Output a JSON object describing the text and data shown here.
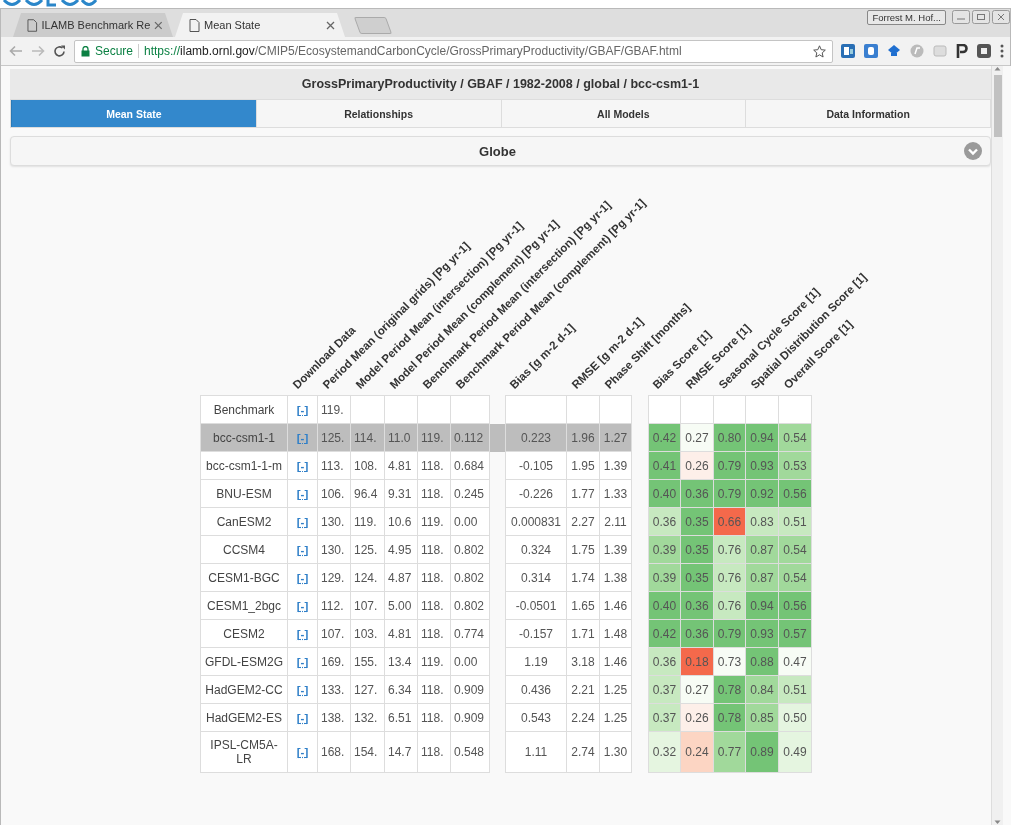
{
  "browser": {
    "tabs": [
      {
        "title": "ILAMB Benchmark Re",
        "selected": false
      },
      {
        "title": "Mean State",
        "selected": true
      }
    ],
    "profile": "Forrest M. Hof...",
    "address": {
      "secure_label": "Secure",
      "scheme": "https://",
      "host": "ilamb.ornl.gov",
      "path": "/CMIP5/EcosystemandCarbonCycle/GrossPrimaryProductivity/GBAF/GBAF.html"
    }
  },
  "page": {
    "title": "GrossPrimaryProductivity / GBAF / 1982-2008 / global / bcc-csm1-1",
    "tabs": [
      {
        "label": "Mean State",
        "selected": true
      },
      {
        "label": "Relationships",
        "selected": false
      },
      {
        "label": "All Models",
        "selected": false
      },
      {
        "label": "Data Information",
        "selected": false
      }
    ],
    "section": {
      "title": "Globe"
    }
  },
  "table": {
    "columns": {
      "means": [
        "Download Data",
        "Period Mean (original grids) [Pg yr-1]",
        "Model Period Mean (intersection) [Pg yr-1]",
        "Model Period Mean (complement) [Pg yr-1]",
        "Benchmark Period Mean (intersection) [Pg yr-1]",
        "Benchmark Period Mean (complement) [Pg yr-1]"
      ],
      "cycle": [
        "Bias [g m-2 d-1]",
        "RMSE [g m-2 d-1]",
        "Phase Shift [months]"
      ],
      "scores": [
        "Bias Score [1]",
        "RMSE Score [1]",
        "Seasonal Cycle Score [1]",
        "Spatial Distribution Score [1]",
        "Overall Score [1]"
      ]
    },
    "rows": [
      {
        "model": "Benchmark",
        "selected": false,
        "download": "[-]",
        "means": [
          "119."
        ]
      },
      {
        "model": "bcc-csm1-1",
        "selected": true,
        "download": "[-]",
        "means": [
          "125.",
          "114.",
          "11.0",
          "119.",
          "0.112"
        ],
        "cycle": [
          "0.223",
          "1.96",
          "1.27"
        ],
        "scores": [
          {
            "value": "0.42",
            "color": "#74c476"
          },
          {
            "value": "0.27",
            "color": "#f7fcf5"
          },
          {
            "value": "0.80",
            "color": "#74c476"
          },
          {
            "value": "0.94",
            "color": "#74c476"
          },
          {
            "value": "0.54",
            "color": "#a1d99b"
          }
        ]
      },
      {
        "model": "bcc-csm1-1-m",
        "selected": false,
        "download": "[-]",
        "means": [
          "113.",
          "108.",
          "4.81",
          "118.",
          "0.684"
        ],
        "cycle": [
          "-0.105",
          "1.95",
          "1.39"
        ],
        "scores": [
          {
            "value": "0.41",
            "color": "#74c476"
          },
          {
            "value": "0.26",
            "color": "#fdefe9"
          },
          {
            "value": "0.79",
            "color": "#74c476"
          },
          {
            "value": "0.93",
            "color": "#74c476"
          },
          {
            "value": "0.53",
            "color": "#a1d99b"
          }
        ]
      },
      {
        "model": "BNU-ESM",
        "selected": false,
        "download": "[-]",
        "means": [
          "106.",
          "96.4",
          "9.31",
          "118.",
          "0.245"
        ],
        "cycle": [
          "-0.226",
          "1.77",
          "1.33"
        ],
        "scores": [
          {
            "value": "0.40",
            "color": "#74c476"
          },
          {
            "value": "0.36",
            "color": "#74c476"
          },
          {
            "value": "0.79",
            "color": "#74c476"
          },
          {
            "value": "0.92",
            "color": "#74c476"
          },
          {
            "value": "0.56",
            "color": "#74c476"
          }
        ]
      },
      {
        "model": "CanESM2",
        "selected": false,
        "download": "[-]",
        "means": [
          "130.",
          "119.",
          "10.6",
          "119.",
          "0.00"
        ],
        "cycle": [
          "0.000831",
          "2.27",
          "2.11"
        ],
        "scores": [
          {
            "value": "0.36",
            "color": "#c7e9c0"
          },
          {
            "value": "0.35",
            "color": "#74c476"
          },
          {
            "value": "0.66",
            "color": "#f4694b"
          },
          {
            "value": "0.83",
            "color": "#c7e9c0"
          },
          {
            "value": "0.51",
            "color": "#c7e9c0"
          }
        ]
      },
      {
        "model": "CCSM4",
        "selected": false,
        "download": "[-]",
        "means": [
          "130.",
          "125.",
          "4.95",
          "118.",
          "0.802"
        ],
        "cycle": [
          "0.324",
          "1.75",
          "1.39"
        ],
        "scores": [
          {
            "value": "0.39",
            "color": "#a1d99b"
          },
          {
            "value": "0.35",
            "color": "#74c476"
          },
          {
            "value": "0.76",
            "color": "#c7e9c0"
          },
          {
            "value": "0.87",
            "color": "#a1d99b"
          },
          {
            "value": "0.54",
            "color": "#a1d99b"
          }
        ]
      },
      {
        "model": "CESM1-BGC",
        "selected": false,
        "download": "[-]",
        "means": [
          "129.",
          "124.",
          "4.87",
          "118.",
          "0.802"
        ],
        "cycle": [
          "0.314",
          "1.74",
          "1.38"
        ],
        "scores": [
          {
            "value": "0.39",
            "color": "#a1d99b"
          },
          {
            "value": "0.35",
            "color": "#74c476"
          },
          {
            "value": "0.76",
            "color": "#c7e9c0"
          },
          {
            "value": "0.87",
            "color": "#a1d99b"
          },
          {
            "value": "0.54",
            "color": "#a1d99b"
          }
        ]
      },
      {
        "model": "CESM1_2bgc",
        "selected": false,
        "download": "[-]",
        "means": [
          "112.",
          "107.",
          "5.00",
          "118.",
          "0.802"
        ],
        "cycle": [
          "-0.0501",
          "1.65",
          "1.46"
        ],
        "scores": [
          {
            "value": "0.40",
            "color": "#74c476"
          },
          {
            "value": "0.36",
            "color": "#74c476"
          },
          {
            "value": "0.76",
            "color": "#c7e9c0"
          },
          {
            "value": "0.94",
            "color": "#74c476"
          },
          {
            "value": "0.56",
            "color": "#74c476"
          }
        ]
      },
      {
        "model": "CESM2",
        "selected": false,
        "download": "[-]",
        "means": [
          "107.",
          "103.",
          "4.81",
          "118.",
          "0.774"
        ],
        "cycle": [
          "-0.157",
          "1.71",
          "1.48"
        ],
        "scores": [
          {
            "value": "0.42",
            "color": "#74c476"
          },
          {
            "value": "0.36",
            "color": "#74c476"
          },
          {
            "value": "0.79",
            "color": "#74c476"
          },
          {
            "value": "0.93",
            "color": "#74c476"
          },
          {
            "value": "0.57",
            "color": "#74c476"
          }
        ]
      },
      {
        "model": "GFDL-ESM2G",
        "selected": false,
        "download": "[-]",
        "means": [
          "169.",
          "155.",
          "13.4",
          "119.",
          "0.00"
        ],
        "cycle": [
          "1.19",
          "3.18",
          "1.46"
        ],
        "scores": [
          {
            "value": "0.36",
            "color": "#c7e9c0"
          },
          {
            "value": "0.18",
            "color": "#f4694b"
          },
          {
            "value": "0.73",
            "color": "#f7fcf5"
          },
          {
            "value": "0.88",
            "color": "#74c476"
          },
          {
            "value": "0.47",
            "color": "#f7fcf5"
          }
        ]
      },
      {
        "model": "HadGEM2-CC",
        "selected": false,
        "download": "[-]",
        "means": [
          "133.",
          "127.",
          "6.34",
          "118.",
          "0.909"
        ],
        "cycle": [
          "0.436",
          "2.21",
          "1.25"
        ],
        "scores": [
          {
            "value": "0.37",
            "color": "#c7e9c0"
          },
          {
            "value": "0.27",
            "color": "#f7fcf5"
          },
          {
            "value": "0.78",
            "color": "#74c476"
          },
          {
            "value": "0.84",
            "color": "#a1d99b"
          },
          {
            "value": "0.51",
            "color": "#c7e9c0"
          }
        ]
      },
      {
        "model": "HadGEM2-ES",
        "selected": false,
        "download": "[-]",
        "means": [
          "138.",
          "132.",
          "6.51",
          "118.",
          "0.909"
        ],
        "cycle": [
          "0.543",
          "2.24",
          "1.25"
        ],
        "scores": [
          {
            "value": "0.37",
            "color": "#c7e9c0"
          },
          {
            "value": "0.26",
            "color": "#fdefe9"
          },
          {
            "value": "0.78",
            "color": "#74c476"
          },
          {
            "value": "0.85",
            "color": "#a1d99b"
          },
          {
            "value": "0.50",
            "color": "#e5f5e0"
          }
        ]
      },
      {
        "model": "IPSL-CM5A-LR",
        "selected": false,
        "download": "[-]",
        "means": [
          "168.",
          "154.",
          "14.7",
          "118.",
          "0.548"
        ],
        "cycle": [
          "1.11",
          "2.74",
          "1.30"
        ],
        "scores": [
          {
            "value": "0.32",
            "color": "#e5f5e0"
          },
          {
            "value": "0.24",
            "color": "#fcd5c3"
          },
          {
            "value": "0.77",
            "color": "#a1d99b"
          },
          {
            "value": "0.89",
            "color": "#74c476"
          },
          {
            "value": "0.49",
            "color": "#e5f5e0"
          }
        ]
      }
    ]
  }
}
